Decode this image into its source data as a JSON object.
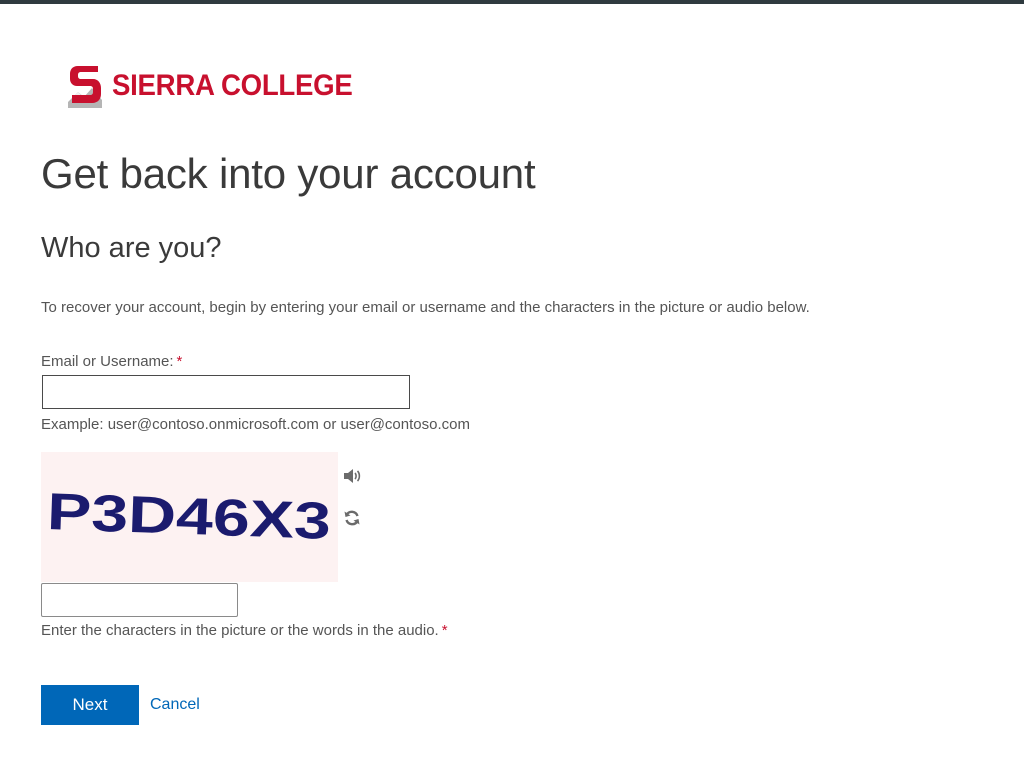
{
  "brand": {
    "name": "SIERRA COLLEGE",
    "logo_icon": "sierra-s-mountain-logo",
    "color": "#c8102e"
  },
  "page": {
    "title": "Get back into your account",
    "subtitle": "Who are you?",
    "instructions": "To recover your account, begin by entering your email or username and the characters in the picture or audio below."
  },
  "form": {
    "email_label": "Email or Username:",
    "required_marker": "*",
    "email_value": "",
    "email_placeholder": "",
    "email_example": "Example: user@contoso.onmicrosoft.com or user@contoso.com",
    "captcha_text": "P3D46X3",
    "captcha_audio_icon": "speaker-icon",
    "captcha_refresh_icon": "refresh-icon",
    "captcha_value": "",
    "captcha_help": "Enter the characters in the picture or the words in the audio."
  },
  "actions": {
    "next_label": "Next",
    "cancel_label": "Cancel",
    "accent_color": "#0067b8"
  }
}
